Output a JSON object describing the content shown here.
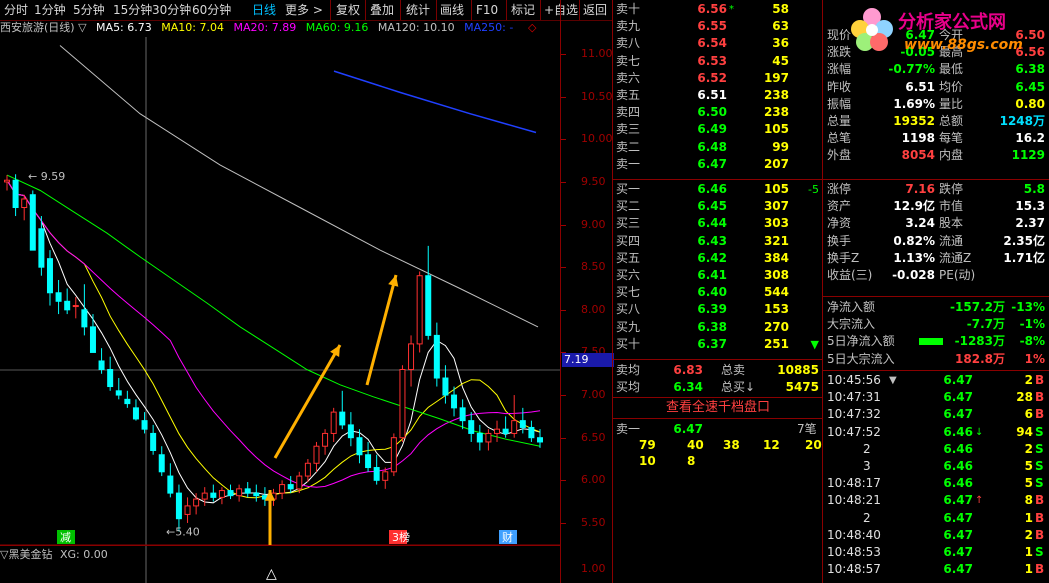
{
  "toolbar": {
    "items": [
      "分时",
      "1分钟",
      "5分钟",
      "15分钟",
      "30分钟",
      "60分钟",
      "日线",
      "更多 >",
      "复权",
      "叠加",
      "统计",
      "画线",
      "F10",
      "标记",
      "+自选",
      "返回"
    ],
    "active_index": 6
  },
  "legend": {
    "title": "西安旅游(日线) ▽",
    "ma5": "MA5: 6.73",
    "ma10": "MA10: 7.04",
    "ma20": "MA20: 7.89",
    "ma60": "MA60: 9.16",
    "ma120": "MA120: 10.10",
    "ma250": "MA250: -",
    "colors": {
      "ma5": "#ffffff",
      "ma10": "#ffff00",
      "ma20": "#ff00ff",
      "ma60": "#00ff00",
      "ma120": "#c0c0c0",
      "ma250": "#2040ff"
    }
  },
  "chart_data": {
    "type": "candlestick",
    "y_ticks": [
      "11.00",
      "10.50",
      "10.00",
      "9.50",
      "9.00",
      "8.50",
      "8.00",
      "7.50",
      "7.00",
      "6.50",
      "6.00",
      "5.50"
    ],
    "ylim": [
      5.3,
      11.2
    ],
    "high_label": "9.59",
    "low_label": "5.40",
    "current_price_tag": "7.19",
    "markers": [
      "减",
      "3榜",
      "财"
    ],
    "candles": [
      [
        9.5,
        9.58,
        9.4,
        9.52
      ],
      [
        9.52,
        9.59,
        9.1,
        9.2
      ],
      [
        9.2,
        9.35,
        9.05,
        9.3
      ],
      [
        9.35,
        9.4,
        8.8,
        8.7
      ],
      [
        8.95,
        9.1,
        8.4,
        8.5
      ],
      [
        8.6,
        8.7,
        8.05,
        8.2
      ],
      [
        8.2,
        8.35,
        7.95,
        8.1
      ],
      [
        8.1,
        8.25,
        7.95,
        8.0
      ],
      [
        8.05,
        8.15,
        7.9,
        8.05
      ],
      [
        8.0,
        8.3,
        7.7,
        7.8
      ],
      [
        7.8,
        7.95,
        7.6,
        7.5
      ],
      [
        7.4,
        7.55,
        7.25,
        7.3
      ],
      [
        7.3,
        7.45,
        7.05,
        7.1
      ],
      [
        7.05,
        7.2,
        6.95,
        7.0
      ],
      [
        6.95,
        7.05,
        6.85,
        6.9
      ],
      [
        6.85,
        6.95,
        6.7,
        6.72
      ],
      [
        6.7,
        6.8,
        6.55,
        6.6
      ],
      [
        6.55,
        6.65,
        6.3,
        6.35
      ],
      [
        6.3,
        6.4,
        6.05,
        6.1
      ],
      [
        6.05,
        6.2,
        5.8,
        5.85
      ],
      [
        5.85,
        5.95,
        5.4,
        5.55
      ],
      [
        5.6,
        5.8,
        5.5,
        5.7
      ],
      [
        5.7,
        5.85,
        5.6,
        5.78
      ],
      [
        5.78,
        5.92,
        5.7,
        5.85
      ],
      [
        5.85,
        5.95,
        5.75,
        5.8
      ],
      [
        5.8,
        5.92,
        5.72,
        5.88
      ],
      [
        5.88,
        5.95,
        5.78,
        5.82
      ],
      [
        5.82,
        5.95,
        5.75,
        5.9
      ],
      [
        5.9,
        5.98,
        5.8,
        5.85
      ],
      [
        5.85,
        5.95,
        5.75,
        5.82
      ],
      [
        5.82,
        5.92,
        5.7,
        5.78
      ],
      [
        5.78,
        5.9,
        5.7,
        5.85
      ],
      [
        5.85,
        6.0,
        5.78,
        5.95
      ],
      [
        5.95,
        6.05,
        5.85,
        5.9
      ],
      [
        5.9,
        6.1,
        5.85,
        6.05
      ],
      [
        6.05,
        6.25,
        5.98,
        6.2
      ],
      [
        6.2,
        6.45,
        6.1,
        6.4
      ],
      [
        6.4,
        6.6,
        6.3,
        6.55
      ],
      [
        6.55,
        6.85,
        6.45,
        6.8
      ],
      [
        6.8,
        7.05,
        6.6,
        6.65
      ],
      [
        6.65,
        6.8,
        6.4,
        6.5
      ],
      [
        6.5,
        6.6,
        6.2,
        6.3
      ],
      [
        6.3,
        6.45,
        6.1,
        6.15
      ],
      [
        6.15,
        6.3,
        5.95,
        6.0
      ],
      [
        6.0,
        6.15,
        5.9,
        6.1
      ],
      [
        6.1,
        6.55,
        6.05,
        6.5
      ],
      [
        6.5,
        7.35,
        6.45,
        7.3
      ],
      [
        7.3,
        7.7,
        7.1,
        7.6
      ],
      [
        7.6,
        8.45,
        7.5,
        8.4
      ],
      [
        8.4,
        8.75,
        7.65,
        7.7
      ],
      [
        7.7,
        7.85,
        7.1,
        7.2
      ],
      [
        7.2,
        7.35,
        6.9,
        7.0
      ],
      [
        7.0,
        7.1,
        6.75,
        6.85
      ],
      [
        6.85,
        6.95,
        6.6,
        6.7
      ],
      [
        6.7,
        6.8,
        6.45,
        6.55
      ],
      [
        6.55,
        6.65,
        6.35,
        6.45
      ],
      [
        6.45,
        6.6,
        6.35,
        6.55
      ],
      [
        6.55,
        6.7,
        6.45,
        6.6
      ],
      [
        6.6,
        6.75,
        6.5,
        6.55
      ],
      [
        6.55,
        7.0,
        6.5,
        6.7
      ],
      [
        6.7,
        6.85,
        6.55,
        6.62
      ],
      [
        6.62,
        6.7,
        6.45,
        6.5
      ],
      [
        6.5,
        6.6,
        6.38,
        6.45
      ]
    ]
  },
  "indicator": {
    "name": "▽黑美金钻",
    "value": "XG: 0.00"
  },
  "orderbook": {
    "asks": [
      {
        "label": "卖十",
        "price": "6.56",
        "vol": "58",
        "mark": "*"
      },
      {
        "label": "卖九",
        "price": "6.55",
        "vol": "63",
        "mark": ""
      },
      {
        "label": "卖八",
        "price": "6.54",
        "vol": "36",
        "mark": ""
      },
      {
        "label": "卖七",
        "price": "6.53",
        "vol": "45",
        "mark": ""
      },
      {
        "label": "卖六",
        "price": "6.52",
        "vol": "197",
        "mark": ""
      },
      {
        "label": "卖五",
        "price": "6.51",
        "vol": "238",
        "mark": ""
      },
      {
        "label": "卖四",
        "price": "6.50",
        "vol": "238",
        "mark": ""
      },
      {
        "label": "卖三",
        "price": "6.49",
        "vol": "105",
        "mark": ""
      },
      {
        "label": "卖二",
        "price": "6.48",
        "vol": "99",
        "mark": ""
      },
      {
        "label": "卖一",
        "price": "6.47",
        "vol": "207",
        "mark": ""
      }
    ],
    "bids": [
      {
        "label": "买一",
        "price": "6.46",
        "vol": "105",
        "chg": "-5"
      },
      {
        "label": "买二",
        "price": "6.45",
        "vol": "307",
        "chg": ""
      },
      {
        "label": "买三",
        "price": "6.44",
        "vol": "303",
        "chg": ""
      },
      {
        "label": "买四",
        "price": "6.43",
        "vol": "321",
        "chg": ""
      },
      {
        "label": "买五",
        "price": "6.42",
        "vol": "384",
        "chg": ""
      },
      {
        "label": "买六",
        "price": "6.41",
        "vol": "308",
        "chg": ""
      },
      {
        "label": "买七",
        "price": "6.40",
        "vol": "544",
        "chg": ""
      },
      {
        "label": "买八",
        "price": "6.39",
        "vol": "153",
        "chg": ""
      },
      {
        "label": "买九",
        "price": "6.38",
        "vol": "270",
        "chg": ""
      },
      {
        "label": "买十",
        "price": "6.37",
        "vol": "251",
        "chg": "▼"
      }
    ],
    "avg_sell_label": "卖均",
    "avg_sell": "6.83",
    "total_sell_label": "总卖",
    "total_sell": "10885",
    "avg_buy_label": "买均",
    "avg_buy": "6.34",
    "total_buy_label": "总买",
    "total_buy": "5475",
    "full_depth_button": "查看全速千档盘口",
    "queue_label": "卖一",
    "queue_price": "6.47",
    "queue_count": "7笔",
    "queue_row1": [
      "79",
      "40",
      "38",
      "12",
      "20"
    ],
    "queue_row2": [
      "10",
      "8"
    ]
  },
  "quote": {
    "code_partial": "000610",
    "rows": [
      {
        "l1": "现价",
        "v1": "6.47",
        "c1": "grn",
        "l2": "今开",
        "v2": "6.50",
        "c2": "red"
      },
      {
        "l1": "涨跌",
        "v1": "-0.05",
        "c1": "grn",
        "l2": "最高",
        "v2": "6.56",
        "c2": "red"
      },
      {
        "l1": "涨幅",
        "v1": "-0.77%",
        "c1": "grn",
        "l2": "最低",
        "v2": "6.38",
        "c2": "grn"
      },
      {
        "l1": "昨收",
        "v1": "6.51",
        "c1": "wht",
        "l2": "均价",
        "v2": "6.45",
        "c2": "grn"
      },
      {
        "l1": "振幅",
        "v1": "1.69%",
        "c1": "wht",
        "l2": "量比",
        "v2": "0.80",
        "c2": "yel"
      },
      {
        "l1": "总量",
        "v1": "19352",
        "c1": "yel",
        "l2": "总额",
        "v2": "1248万",
        "c2": "cyan"
      },
      {
        "l1": "总笔",
        "v1": "1198",
        "c1": "wht",
        "l2": "每笔",
        "v2": "16.2",
        "c2": "wht"
      },
      {
        "l1": "外盘",
        "v1": "8054",
        "c1": "red",
        "l2": "内盘",
        "v2": "1129",
        "c2": "grn"
      }
    ],
    "rows2": [
      {
        "l1": "涨停",
        "v1": "7.16",
        "c1": "red",
        "l2": "跌停",
        "v2": "5.8",
        "c2": "grn"
      },
      {
        "l1": "资产",
        "v1": "12.9亿",
        "c1": "wht",
        "l2": "市值",
        "v2": "15.3",
        "c2": "wht"
      },
      {
        "l1": "净资",
        "v1": "3.24",
        "c1": "wht",
        "l2": "股本",
        "v2": "2.37",
        "c2": "wht"
      },
      {
        "l1": "换手",
        "v1": "0.82%",
        "c1": "wht",
        "l2": "流通",
        "v2": "2.35亿",
        "c2": "wht"
      },
      {
        "l1": "换手Z",
        "v1": "1.13%",
        "c1": "wht",
        "l2": "流通Z",
        "v2": "1.71亿",
        "c2": "wht"
      },
      {
        "l1": "收益(三)",
        "v1": "-0.028",
        "c1": "wht",
        "l2": "PE(动)",
        "v2": "",
        "c2": "wht"
      }
    ],
    "flows": [
      {
        "label": "净流入额",
        "value": "-157.2万",
        "pct": "-13%",
        "vc": "grn"
      },
      {
        "label": "大宗流入",
        "value": "-7.7万",
        "pct": "-1%",
        "vc": "grn"
      },
      {
        "label": "5日净流入额",
        "value": "-1283万",
        "pct": "-8%",
        "vc": "grn"
      },
      {
        "label": "5日大宗流入",
        "value": "182.8万",
        "pct": "1%",
        "vc": "red"
      }
    ],
    "ticks": [
      {
        "t": "10:45:56",
        "p": "6.47",
        "a": "",
        "v": "2",
        "s": "B",
        "sc": "red",
        "tri": "▼"
      },
      {
        "t": "10:47:31",
        "p": "6.47",
        "a": "",
        "v": "28",
        "s": "B",
        "sc": "red",
        "tri": ""
      },
      {
        "t": "10:47:32",
        "p": "6.47",
        "a": "",
        "v": "6",
        "s": "B",
        "sc": "red",
        "tri": ""
      },
      {
        "t": "10:47:52",
        "p": "6.46",
        "a": "↓",
        "v": "94",
        "s": "S",
        "sc": "grn",
        "tri": ""
      },
      {
        "t": "2",
        "p": "6.46",
        "a": "",
        "v": "2",
        "s": "S",
        "sc": "grn",
        "tri": ""
      },
      {
        "t": "3",
        "p": "6.46",
        "a": "",
        "v": "5",
        "s": "S",
        "sc": "grn",
        "tri": ""
      },
      {
        "t": "10:48:17",
        "p": "6.46",
        "a": "",
        "v": "5",
        "s": "S",
        "sc": "grn",
        "tri": ""
      },
      {
        "t": "10:48:21",
        "p": "6.47",
        "a": "↑",
        "v": "8",
        "s": "B",
        "sc": "red",
        "tri": ""
      },
      {
        "t": "2",
        "p": "6.47",
        "a": "",
        "v": "1",
        "s": "B",
        "sc": "red",
        "tri": ""
      },
      {
        "t": "10:48:40",
        "p": "6.47",
        "a": "",
        "v": "2",
        "s": "B",
        "sc": "red",
        "tri": ""
      },
      {
        "t": "10:48:53",
        "p": "6.47",
        "a": "",
        "v": "1",
        "s": "S",
        "sc": "grn",
        "tri": ""
      },
      {
        "t": "10:48:57",
        "p": "6.47",
        "a": "",
        "v": "1",
        "s": "B",
        "sc": "red",
        "tri": ""
      }
    ]
  },
  "logo": {
    "name": "分析家公式网",
    "url": "www.88gs.com"
  }
}
